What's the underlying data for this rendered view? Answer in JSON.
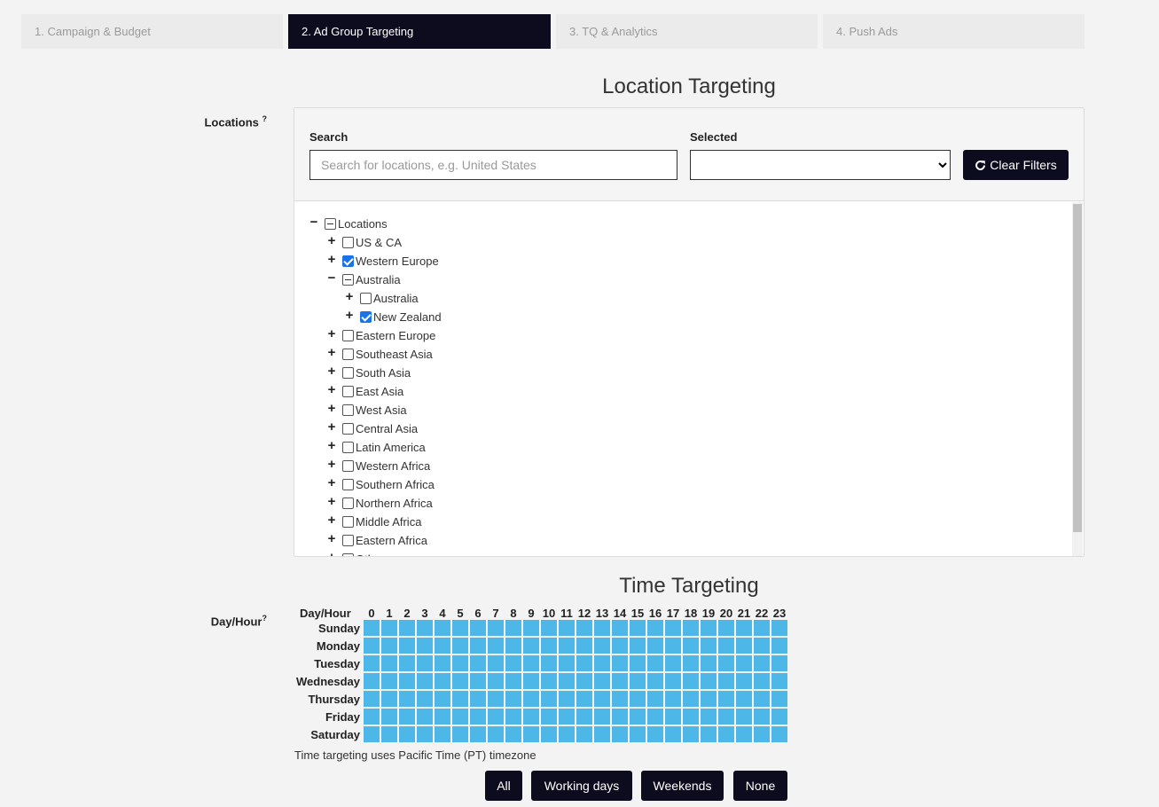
{
  "steps": [
    {
      "label": "1. Campaign & Budget",
      "active": false
    },
    {
      "label": "2. Ad Group Targeting",
      "active": true
    },
    {
      "label": "3. TQ & Analytics",
      "active": false
    },
    {
      "label": "4. Push Ads",
      "active": false
    }
  ],
  "location": {
    "title": "Location Targeting",
    "side_label": "Locations",
    "help_mark": "?",
    "search_label": "Search",
    "search_placeholder": "Search for locations, e.g. United States",
    "search_value": "",
    "selected_label": "Selected",
    "selected_value": "",
    "clear_button": "Clear Filters",
    "tree": [
      {
        "label": "Locations",
        "level": 0,
        "toggle": "minus",
        "state": "partial"
      },
      {
        "label": "US & CA",
        "level": 1,
        "toggle": "plus",
        "state": "unchecked"
      },
      {
        "label": "Western Europe",
        "level": 1,
        "toggle": "plus",
        "state": "checked"
      },
      {
        "label": "Australia",
        "level": 1,
        "toggle": "minus",
        "state": "partial"
      },
      {
        "label": "Australia",
        "level": 2,
        "toggle": "plus",
        "state": "unchecked"
      },
      {
        "label": "New Zealand",
        "level": 2,
        "toggle": "plus",
        "state": "checked"
      },
      {
        "label": "Eastern Europe",
        "level": 1,
        "toggle": "plus",
        "state": "unchecked"
      },
      {
        "label": "Southeast Asia",
        "level": 1,
        "toggle": "plus",
        "state": "unchecked"
      },
      {
        "label": "South Asia",
        "level": 1,
        "toggle": "plus",
        "state": "unchecked"
      },
      {
        "label": "East Asia",
        "level": 1,
        "toggle": "plus",
        "state": "unchecked"
      },
      {
        "label": "West Asia",
        "level": 1,
        "toggle": "plus",
        "state": "unchecked"
      },
      {
        "label": "Central Asia",
        "level": 1,
        "toggle": "plus",
        "state": "unchecked"
      },
      {
        "label": "Latin America",
        "level": 1,
        "toggle": "plus",
        "state": "unchecked"
      },
      {
        "label": "Western Africa",
        "level": 1,
        "toggle": "plus",
        "state": "unchecked"
      },
      {
        "label": "Southern Africa",
        "level": 1,
        "toggle": "plus",
        "state": "unchecked"
      },
      {
        "label": "Northern Africa",
        "level": 1,
        "toggle": "plus",
        "state": "unchecked"
      },
      {
        "label": "Middle Africa",
        "level": 1,
        "toggle": "plus",
        "state": "unchecked"
      },
      {
        "label": "Eastern Africa",
        "level": 1,
        "toggle": "plus",
        "state": "unchecked"
      },
      {
        "label": "Other",
        "level": 1,
        "toggle": "plus",
        "state": "unchecked"
      }
    ]
  },
  "time": {
    "title": "Time Targeting",
    "side_label": "Day/Hour",
    "help_mark": "?",
    "header_label": "Day/Hour",
    "hours": [
      "0",
      "1",
      "2",
      "3",
      "4",
      "5",
      "6",
      "7",
      "8",
      "9",
      "10",
      "11",
      "12",
      "13",
      "14",
      "15",
      "16",
      "17",
      "18",
      "19",
      "20",
      "21",
      "22",
      "23"
    ],
    "days": [
      "Sunday",
      "Monday",
      "Tuesday",
      "Wednesday",
      "Thursday",
      "Friday",
      "Saturday"
    ],
    "all_cells_selected": true,
    "note": "Time targeting uses Pacific Time (PT) timezone",
    "buttons": [
      "All",
      "Working days",
      "Weekends",
      "None"
    ]
  },
  "colors": {
    "primary_dark": "#0d0b1e",
    "cell_selected": "#4db8e8",
    "checkbox_checked": "#1a73e8"
  }
}
